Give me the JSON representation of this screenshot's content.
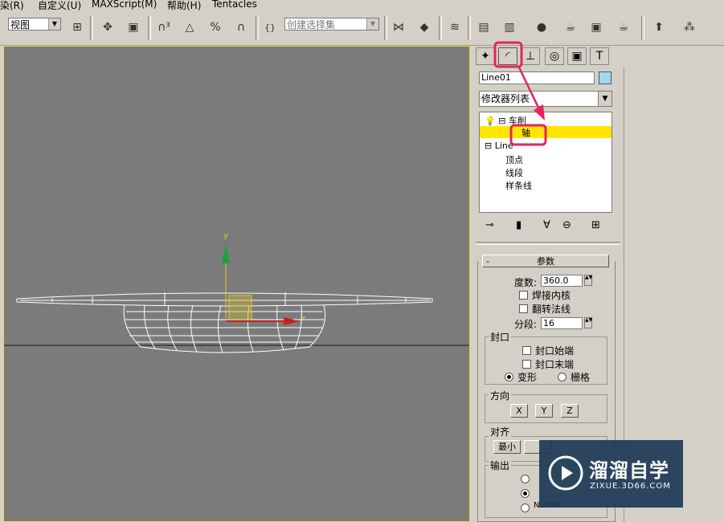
{
  "menu": {
    "items": [
      "染(R)",
      "自定义(U)",
      "MAXScript(M)",
      "帮助(H)",
      "Tentacles"
    ]
  },
  "toolbar": {
    "view_combo": "视图",
    "selection_set_placeholder": "创建选择集"
  },
  "viewport": {
    "axis_y": "y",
    "axis_x": "x"
  },
  "command_panel": {
    "object_name": "Line01",
    "object_color": "#9ed9f2",
    "modifier_list": "修改器列表",
    "stack": {
      "lathe": "车削",
      "axis": "轴",
      "line": "Line",
      "vertex": "顶点",
      "segment": "线段",
      "spline": "样条线"
    },
    "params": {
      "rollout_title": "参数",
      "degrees_label": "度数:",
      "degrees_value": "360.0",
      "weld_core": "焊接内核",
      "flip_normals": "翻转法线",
      "segments_label": "分段:",
      "segments_value": "16",
      "capping_title": "封口",
      "cap_start": "封口始端",
      "cap_end": "封口末端",
      "morph": "变形",
      "grid": "栅格",
      "direction_title": "方向",
      "dir_x": "X",
      "dir_y": "Y",
      "dir_z": "Z",
      "align_title": "对齐",
      "align_min": "最小",
      "output_title": "输出",
      "output_nurbs": "NURBS"
    }
  },
  "watermark": {
    "title": "溜溜自学",
    "url": "ZIXUE.3D66.COM"
  },
  "colors": {
    "highlight": "#ffe600",
    "annotation": "#e6245c",
    "viewport_bg": "#7b7b7b"
  }
}
